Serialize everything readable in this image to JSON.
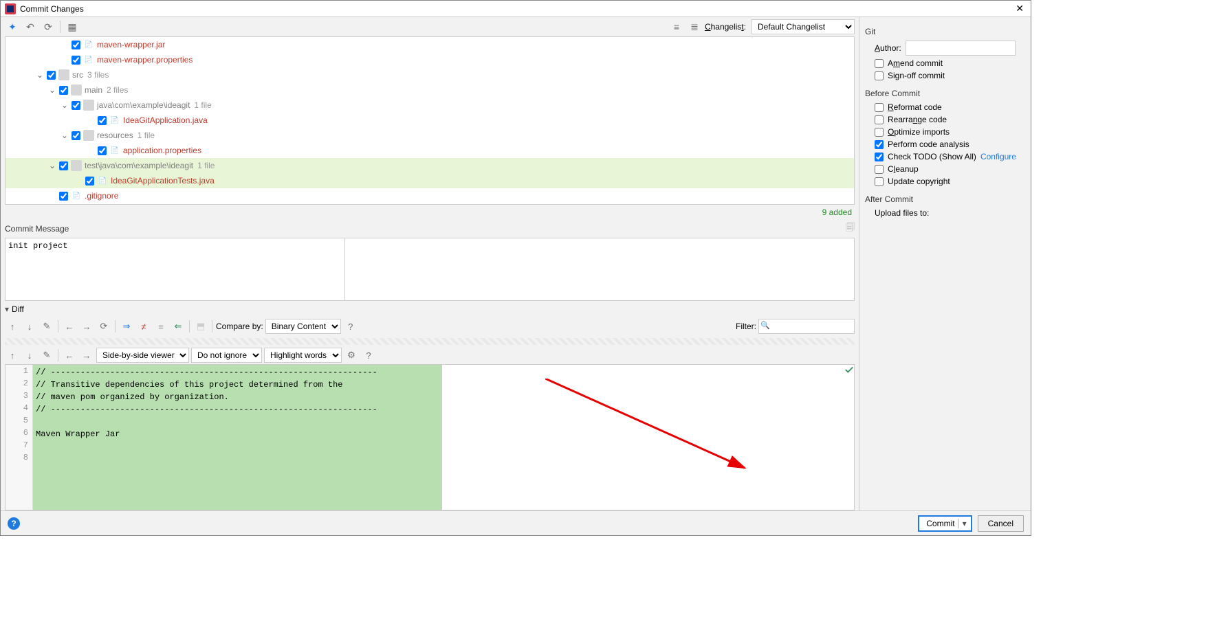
{
  "window": {
    "title": "Commit Changes"
  },
  "toolbar": {
    "changelist_label": "Changelist:",
    "changelist_value": "Default Changelist"
  },
  "tree": {
    "items": [
      {
        "indent": 80,
        "chev": "",
        "checked": true,
        "iconType": "file",
        "name": "maven-wrapper.jar",
        "color": "red",
        "suffix": ""
      },
      {
        "indent": 80,
        "chev": "",
        "checked": true,
        "iconType": "file",
        "name": "maven-wrapper.properties",
        "color": "red",
        "suffix": ""
      },
      {
        "indent": 44,
        "chev": "v",
        "checked": true,
        "iconType": "folder",
        "name": "src",
        "color": "gray",
        "suffix": "3 files"
      },
      {
        "indent": 62,
        "chev": "v",
        "checked": true,
        "iconType": "folder",
        "name": "main",
        "color": "gray",
        "suffix": "2 files"
      },
      {
        "indent": 80,
        "chev": "v",
        "checked": true,
        "iconType": "folder",
        "name": "java\\com\\example\\ideagit",
        "color": "gray",
        "suffix": "1 file"
      },
      {
        "indent": 118,
        "chev": "",
        "checked": true,
        "iconType": "file",
        "name": "IdeaGitApplication.java",
        "color": "red",
        "suffix": ""
      },
      {
        "indent": 80,
        "chev": "v",
        "checked": true,
        "iconType": "folder",
        "name": "resources",
        "color": "gray",
        "suffix": "1 file"
      },
      {
        "indent": 118,
        "chev": "",
        "checked": true,
        "iconType": "file",
        "name": "application.properties",
        "color": "red",
        "suffix": ""
      },
      {
        "indent": 62,
        "chev": "v",
        "checked": true,
        "iconType": "folder",
        "name": "test\\java\\com\\example\\ideagit",
        "color": "gray",
        "suffix": "1 file",
        "highlight": true
      },
      {
        "indent": 100,
        "chev": "",
        "checked": true,
        "iconType": "file",
        "name": "IdeaGitApplicationTests.java",
        "color": "red",
        "suffix": "",
        "highlight": true
      },
      {
        "indent": 62,
        "chev": "",
        "checked": true,
        "iconType": "file",
        "name": ".gitignore",
        "color": "red",
        "suffix": ""
      }
    ],
    "added_count": "9 added"
  },
  "commit_message": {
    "label": "Commit Message",
    "value": "init project"
  },
  "diff": {
    "title": "Diff",
    "compare_by_label": "Compare by:",
    "compare_by_value": "Binary Content",
    "filter_label": "Filter:",
    "viewer_mode": "Side-by-side viewer",
    "ignore_mode": "Do not ignore",
    "highlight_mode": "Highlight words",
    "lines": [
      "// ------------------------------------------------------------------",
      "// Transitive dependencies of this project determined from the",
      "// maven pom organized by organization.",
      "// ------------------------------------------------------------------",
      "",
      "Maven Wrapper Jar",
      "",
      ""
    ]
  },
  "git_panel": {
    "title": "Git",
    "author_label": "Author:",
    "author_value": "",
    "amend": "Amend commit",
    "signoff": "Sign-off commit",
    "before_title": "Before Commit",
    "reformat": "Reformat code",
    "rearrange": "Rearrange code",
    "optimize": "Optimize imports",
    "analysis": "Perform code analysis",
    "todo": "Check TODO (Show All)",
    "configure": "Configure",
    "cleanup": "Cleanup",
    "copyright": "Update copyright",
    "after_title": "After Commit",
    "upload": "Upload files to:"
  },
  "footer": {
    "commit": "Commit",
    "cancel": "Cancel"
  }
}
